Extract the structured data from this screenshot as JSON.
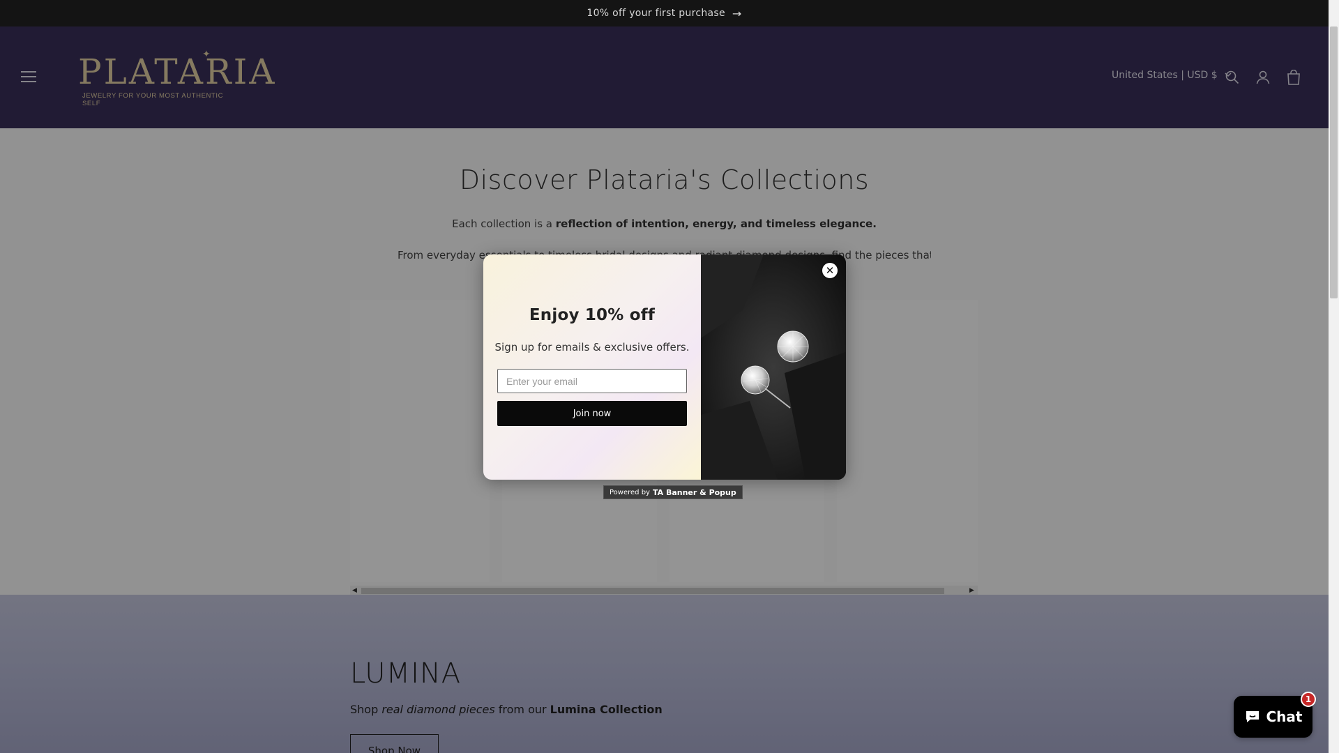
{
  "announcement": {
    "text": "10% off your first purchase",
    "arrow": "→"
  },
  "header": {
    "logo_word": "PLATARIA",
    "logo_tagline": "JEWELRY FOR YOUR MOST AUTHENTIC SELF",
    "country_selector": "United States | USD $",
    "icons": [
      "menu-icon",
      "search-icon",
      "account-icon",
      "cart-icon"
    ]
  },
  "collections": {
    "title": "Discover Plataria's Collections",
    "subtitle_prefix": "Each collection is a ",
    "subtitle_bold": "reflection of intention, energy, and timeless elegance.",
    "description": "From everyday essentials to timeless bridal designs and radiant diamond designs, find the pieces that move with your"
  },
  "popup": {
    "title": "Enjoy 10% off",
    "text": "Sign up for emails & exclusive offers.",
    "email_placeholder": "Enter your email",
    "button_label": "Join now",
    "close_symbol": "✕",
    "powered_prefix": "Powered by",
    "powered_brand": "TA Banner & Popup"
  },
  "lumina": {
    "title": "LUMINA",
    "sub_prefix": "Shop ",
    "sub_italic": "real diamond pieces",
    "sub_middle": " from our ",
    "sub_bold": "Lumina Collection",
    "button_label": "Shop Now"
  },
  "chat": {
    "label": "Chat",
    "badge": "1"
  },
  "colors": {
    "header_bg": "#3a2f5a",
    "logo_gold": "#e5d3a5",
    "announcement_bg": "#141414",
    "chat_badge": "#c62828"
  }
}
